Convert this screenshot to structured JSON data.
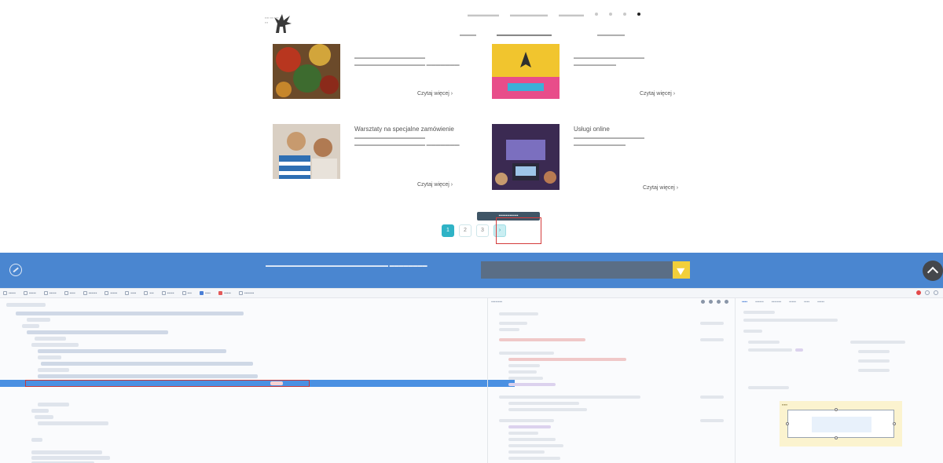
{
  "colors": {
    "accent": "#2fb3c6",
    "newsletter_bar": "#4a86d0",
    "devtools_selection": "#4a90e2",
    "highlight_box": "#d43c3c",
    "send_button": "#f2cf3a"
  },
  "pagination": {
    "pages": [
      "1",
      "2",
      "3"
    ],
    "active_page": "1"
  },
  "articles": [
    {
      "more_label": "Czytaj więcej ›"
    },
    {
      "more_label": "Czytaj więcej ›"
    },
    {
      "title": "Warsztaty na specjalne zamówienie",
      "more_label": "Czytaj więcej ›"
    },
    {
      "title": "Usługi online",
      "more_label": "Czytaj więcej ›"
    }
  ],
  "icons": {
    "logo": "pegasus-logo",
    "newsletter_left": "circle-slash-icon",
    "send": "paper-plane-icon",
    "scroll_top": "chevron-up-icon"
  }
}
